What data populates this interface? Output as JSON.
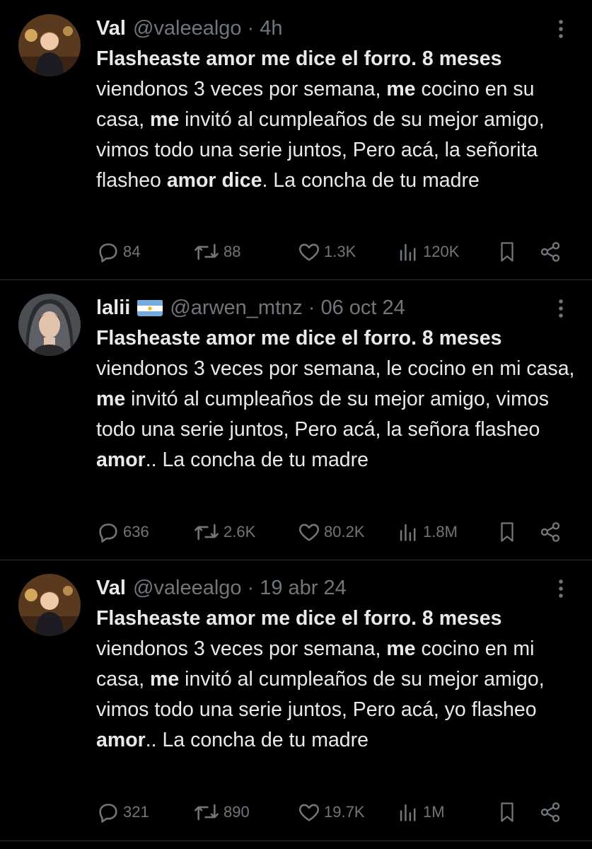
{
  "tweets": [
    {
      "name": "Val",
      "handle": "@valeealgo",
      "time": "4h",
      "flag": false,
      "text": [
        {
          "t": "Flasheaste amor me dice el forro. 8 meses",
          "b": true
        },
        {
          "t": " viendonos 3 veces por semana, ",
          "b": false
        },
        {
          "t": "me",
          "b": true
        },
        {
          "t": " cocino en su casa, ",
          "b": false
        },
        {
          "t": "me",
          "b": true
        },
        {
          "t": " invitó al cumpleaños de su mejor amigo, vimos todo una serie juntos, Pero acá, la señorita flasheo ",
          "b": false
        },
        {
          "t": "amor dice",
          "b": true
        },
        {
          "t": ". La concha de tu madre",
          "b": false
        }
      ],
      "replies": "84",
      "retweets": "88",
      "likes": "1.3K",
      "views": "120K"
    },
    {
      "name": "lalii",
      "handle": "@arwen_mtnz",
      "time": "06 oct 24",
      "flag": true,
      "text": [
        {
          "t": "Flasheaste amor me dice el forro. 8 meses",
          "b": true
        },
        {
          "t": " viendonos 3 veces por semana, le cocino en mi casa, ",
          "b": false
        },
        {
          "t": "me",
          "b": true
        },
        {
          "t": " invitó al  cumpleaños de su mejor  amigo, vimos todo una serie juntos, Pero acá, la señora flasheo ",
          "b": false
        },
        {
          "t": "amor",
          "b": true
        },
        {
          "t": ".. La concha de tu madre",
          "b": false
        }
      ],
      "replies": "636",
      "retweets": "2.6K",
      "likes": "80.2K",
      "views": "1.8M"
    },
    {
      "name": "Val",
      "handle": "@valeealgo",
      "time": "19 abr 24",
      "flag": false,
      "text": [
        {
          "t": "Flasheaste amor me dice el forro. 8 meses",
          "b": true
        },
        {
          "t": " viendonos 3 veces por semana, ",
          "b": false
        },
        {
          "t": "me",
          "b": true
        },
        {
          "t": " cocino en mi casa, ",
          "b": false
        },
        {
          "t": "me",
          "b": true
        },
        {
          "t": " invitó al  cumpleaños de su mejor  amigo, vimos todo una serie juntos, Pero acá, yo flasheo ",
          "b": false
        },
        {
          "t": "amor",
          "b": true
        },
        {
          "t": ".. La concha de tu madre",
          "b": false
        }
      ],
      "replies": "321",
      "retweets": "890",
      "likes": "19.7K",
      "views": "1M"
    }
  ],
  "icons": {
    "reply": "speech-bubble-icon",
    "retweet": "retweet-arrows-icon",
    "like": "heart-icon",
    "views": "bar-chart-icon",
    "bookmark": "bookmark-icon",
    "share": "share-icon",
    "more": "vertical-dots-icon"
  },
  "colors": {
    "background": "#000000",
    "text": "#e7e9ea",
    "muted": "#71767b",
    "divider": "#2f3336"
  }
}
